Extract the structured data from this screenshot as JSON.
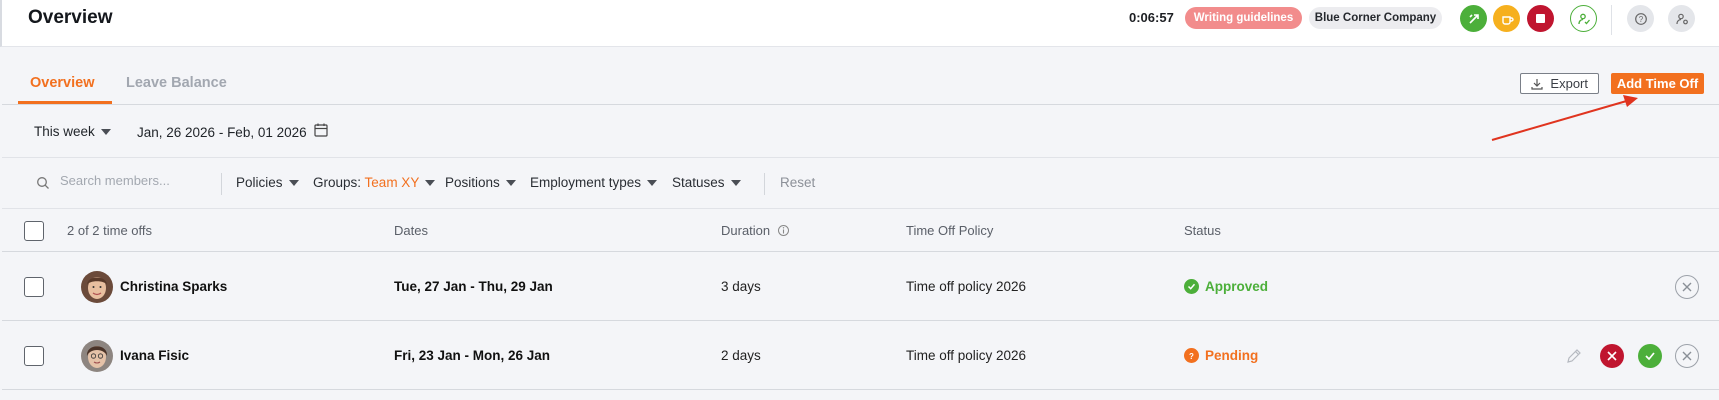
{
  "header": {
    "title": "Overview",
    "timer": "0:06:57",
    "guidelines_label": "Writing guidelines",
    "company_label": "Blue Corner Company",
    "colors": {
      "accent": "#f2701f",
      "guidelines": "#f28c8c",
      "green": "#4caf3a",
      "yellow": "#f6b01e",
      "red": "#c0152f"
    }
  },
  "tabs": [
    {
      "label": "Overview",
      "active": true
    },
    {
      "label": "Leave Balance",
      "active": false
    }
  ],
  "actions": {
    "export_label": "Export",
    "add_label": "Add Time Off"
  },
  "period": {
    "selected": "This week",
    "range": "Jan, 26 2026 - Feb, 01 2026"
  },
  "filters": {
    "search_placeholder": "Search members...",
    "policies": "Policies",
    "groups_label": "Groups",
    "groups_value": "Team XY",
    "positions": "Positions",
    "employment_types": "Employment types",
    "statuses": "Statuses",
    "reset": "Reset"
  },
  "table": {
    "count_label": "2 of 2 time offs",
    "columns": {
      "dates": "Dates",
      "duration": "Duration",
      "policy": "Time Off Policy",
      "status": "Status"
    },
    "rows": [
      {
        "name": "Christina Sparks",
        "dates": "Tue, 27 Jan - Thu, 29 Jan",
        "duration": "3 days",
        "policy": "Time off policy 2026",
        "status": "Approved",
        "status_color": "#4caf3a"
      },
      {
        "name": "Ivana Fisic",
        "dates": "Fri, 23 Jan - Mon, 26 Jan",
        "duration": "2 days",
        "policy": "Time off policy 2026",
        "status": "Pending",
        "status_color": "#f2701f"
      }
    ]
  }
}
